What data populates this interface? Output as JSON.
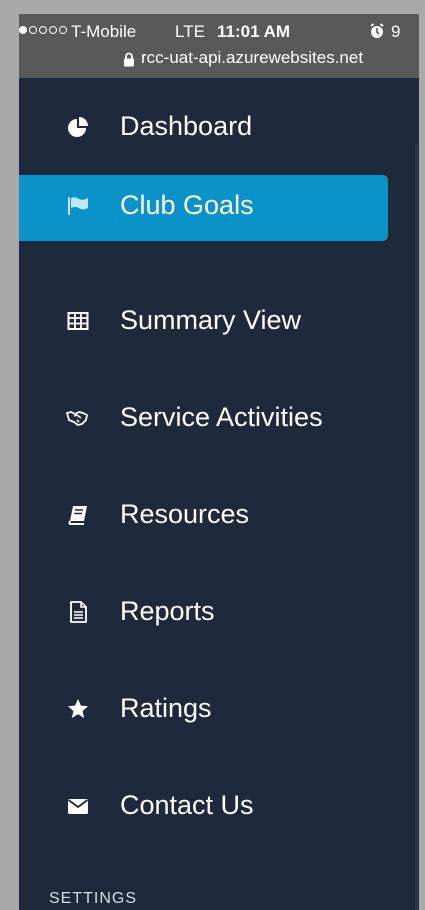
{
  "status_bar": {
    "carrier": "T-Mobile",
    "network": "LTE",
    "time": "11:01 AM",
    "battery_partial": "9",
    "alarm_icon": "alarm-clock-icon",
    "url": "rcc-uat-api.azurewebsites.net",
    "lock_icon": "lock-icon"
  },
  "menu": {
    "items": [
      {
        "label": "Dashboard",
        "icon": "pie-chart-icon"
      },
      {
        "label": "Club Goals",
        "icon": "flag-icon",
        "active": true
      },
      {
        "label": "Summary View",
        "icon": "table-icon"
      },
      {
        "label": "Service Activities",
        "icon": "handshake-icon"
      },
      {
        "label": "Resources",
        "icon": "book-icon"
      },
      {
        "label": "Reports",
        "icon": "document-icon"
      },
      {
        "label": "Ratings",
        "icon": "star-icon"
      },
      {
        "label": "Contact Us",
        "icon": "envelope-icon"
      }
    ]
  },
  "section": {
    "settings": "SETTINGS"
  },
  "colors": {
    "background": "#1e2a3c",
    "active": "#0a93c8",
    "status_bar": "#595959",
    "frame": "#a9a9a9"
  }
}
